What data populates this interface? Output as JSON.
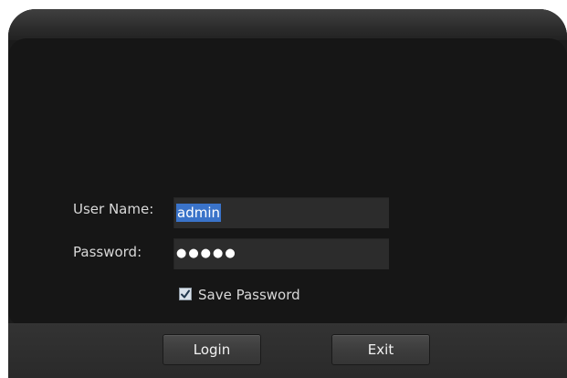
{
  "form": {
    "username_label": "User Name:",
    "username_value": "admin",
    "password_label": "Password:",
    "password_mask": "●●●●●",
    "save_password_label": "Save Password",
    "save_password_checked": true
  },
  "buttons": {
    "login": "Login",
    "exit": "Exit"
  },
  "colors": {
    "window_bg": "#1b1b1b",
    "field_bg": "#2c2c2c",
    "selection": "#3a73c9",
    "text": "#d8d8d8"
  },
  "icons": {
    "checkbox": "checkmark-icon"
  }
}
